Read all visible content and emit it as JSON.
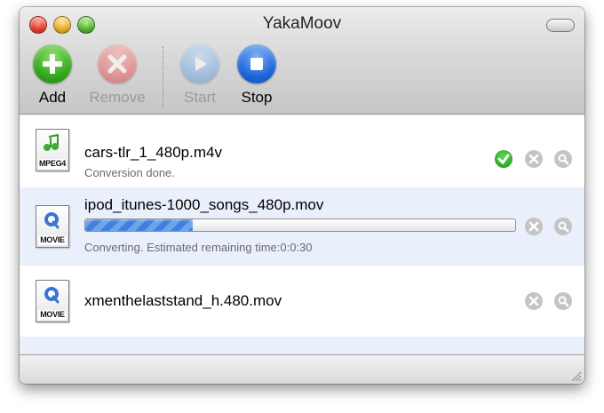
{
  "window": {
    "title": "YakaMoov"
  },
  "toolbar": {
    "add_label": "Add",
    "remove_label": "Remove",
    "start_label": "Start",
    "stop_label": "Stop"
  },
  "files": [
    {
      "name": "cars-tlr_1_480p.m4v",
      "status": "Conversion done.",
      "icon": "mpeg4-file-icon",
      "badge": "MPEG4",
      "state": "done"
    },
    {
      "name": "ipod_itunes-1000_songs_480p.mov",
      "status": "Converting. Estimated remaining time:0:0:30",
      "icon": "quicktime-movie-file-icon",
      "badge": "MOVIE",
      "state": "converting",
      "progress": 0.25
    },
    {
      "name": "xmenthelaststand_h.480.mov",
      "status": "",
      "icon": "quicktime-movie-file-icon",
      "badge": "MOVIE",
      "state": "queued"
    }
  ],
  "colors": {
    "done": "#1da51e",
    "progress": "#3f7fdf",
    "selected_row": "#eaf0fb"
  }
}
